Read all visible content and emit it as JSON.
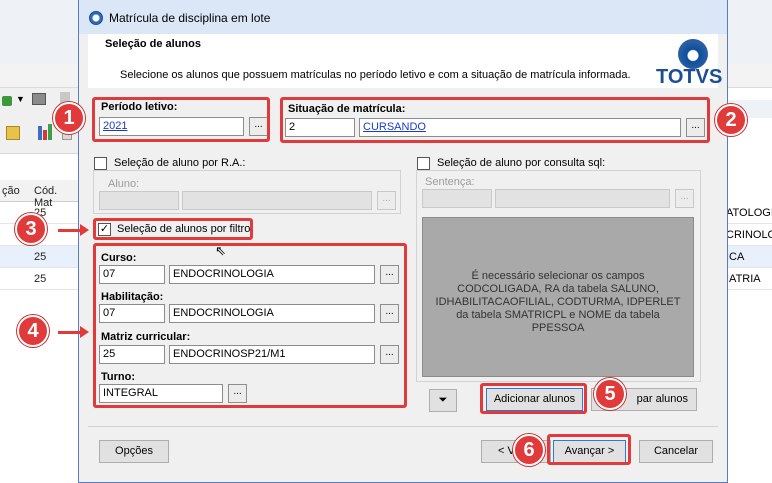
{
  "background_app": {
    "grid_headers": [
      "ção",
      "Cód. Mat"
    ],
    "grid_values": [
      "25",
      "25",
      "25",
      "25"
    ],
    "right_values": [
      "ATOLOGI",
      "CRINOLO",
      "ICA",
      "IATRIA"
    ]
  },
  "dialog": {
    "title": "Matrícula de disciplina em lote",
    "header_title": "Seleção de alunos",
    "header_description": "Selecione os alunos que possuem matrículas no período letivo e com a situação de matrícula informada.",
    "logo_text": "TOTVS"
  },
  "periodo": {
    "label": "Período letivo:",
    "value": "2021"
  },
  "situacao": {
    "label": "Situação de matrícula:",
    "code": "2",
    "description": "CURSANDO"
  },
  "ra_section": {
    "label": "Seleção de aluno por R.A.:",
    "aluno_label": "Aluno:"
  },
  "sql_section": {
    "label": "Seleção de aluno por consulta sql:",
    "sentenca_label": "Sentença:",
    "info_text": "É necessário selecionar os campos CODCOLIGADA, RA da tabela SALUNO, IDHABILITACAOFILIAL, CODTURMA, IDPERLET da tabela SMATRICPL e NOME da tabela PPESSOA"
  },
  "filter_section": {
    "label": "Seleção de alunos por filtro:",
    "curso": {
      "label": "Curso:",
      "code": "07",
      "name": "ENDOCRINOLOGIA"
    },
    "habilitacao": {
      "label": "Habilitação:",
      "code": "07",
      "name": "ENDOCRINOLOGIA"
    },
    "matriz": {
      "label": "Matriz curricular:",
      "code": "25",
      "name": "ENDOCRINOSP21/M1"
    },
    "turno": {
      "label": "Turno:",
      "value": "INTEGRAL"
    }
  },
  "buttons": {
    "ellipsis": "...",
    "add_students": "Adicionar alunos",
    "clear_students": "par alunos",
    "options": "Opções",
    "back": "< Vo",
    "next": "Avançar >",
    "cancel": "Cancelar"
  },
  "annotations": [
    "1",
    "2",
    "3",
    "4",
    "5",
    "6"
  ],
  "colors": {
    "annotation": "#e03a3a",
    "link": "#1a3ad0",
    "dialog_bg": "#f0f0f0",
    "logo": "#1a4f93"
  }
}
